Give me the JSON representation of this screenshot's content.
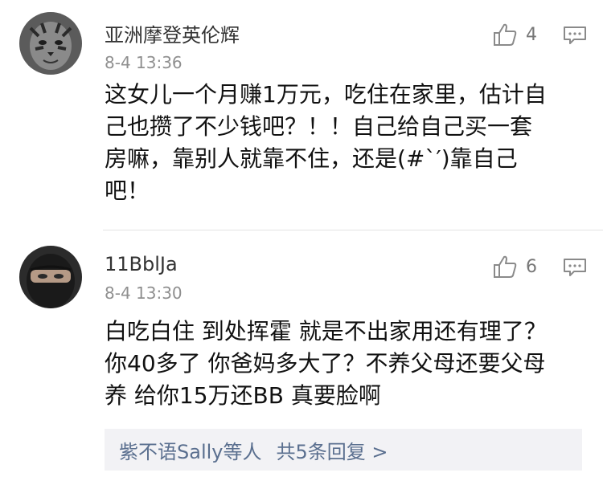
{
  "comments": [
    {
      "username": "亚洲摩登英伦辉",
      "time": "8-4 13:36",
      "likes": "4",
      "avatar_icon": "tiger-face-avatar",
      "lines": [
        "这女儿一个月赚1万元，吃住在家里，估计自",
        "己也攒了不少钱吧？！！自己给自己买一套",
        "房嘛，靠别人就靠不住，还是(#`′)靠自己",
        "吧！"
      ]
    },
    {
      "username": "11BblJa",
      "time": "8-4 13:30",
      "likes": "6",
      "avatar_icon": "masked-face-avatar",
      "lines": [
        "白吃白住 到处挥霍 就是不出家用还有理了？",
        "你40多了 你爸妈多大了？不养父母还要父母",
        "养 给你15万还BB 真要脸啊"
      ],
      "replies": {
        "users": "紫不语Sally等人",
        "count": "共5条回复 >"
      }
    }
  ],
  "colors": {
    "link_blue": "#5a6f8f",
    "reply_bg": "#f2f2f5",
    "time_gray": "#8f8f8f"
  }
}
